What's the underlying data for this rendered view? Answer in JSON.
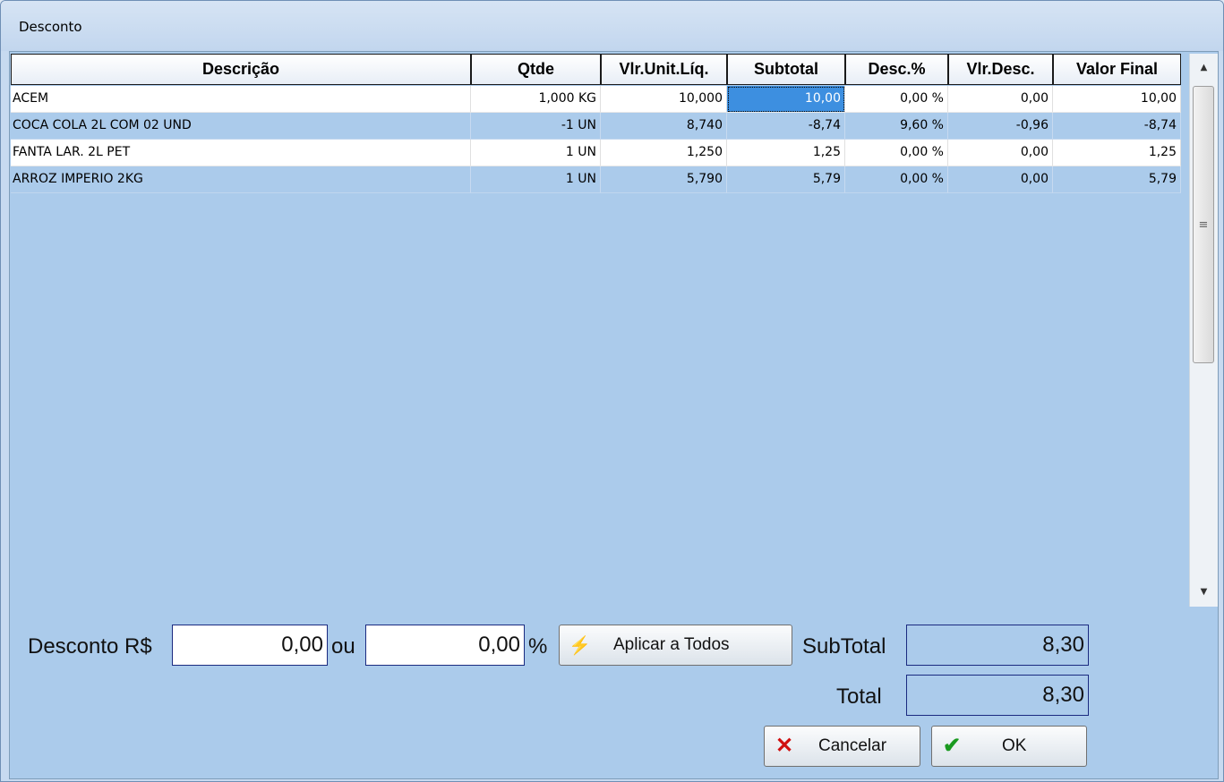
{
  "window": {
    "title": "Desconto"
  },
  "grid": {
    "columns": [
      "Descrição",
      "Qtde",
      "Vlr.Unit.Líq.",
      "Subtotal",
      "Desc.%",
      "Vlr.Desc.",
      "Valor Final"
    ],
    "rows": [
      [
        "ACEM",
        "1,000 KG",
        "10,000",
        "10,00",
        "0,00 %",
        "0,00",
        "10,00"
      ],
      [
        "COCA COLA 2L COM 02 UND",
        "-1 UN",
        "8,740",
        "-8,74",
        "9,60 %",
        "-0,96",
        "-8,74"
      ],
      [
        "FANTA LAR. 2L PET",
        "1 UN",
        "1,250",
        "1,25",
        "0,00 %",
        "0,00",
        "1,25"
      ],
      [
        "ARROZ IMPERIO 2KG",
        "1 UN",
        "5,790",
        "5,79",
        "0,00 %",
        "0,00",
        "5,79"
      ]
    ]
  },
  "scrollbar": {
    "up_icon": "arrow-up-icon",
    "down_icon": "arrow-down-icon"
  },
  "footer": {
    "desconto_label": "Desconto R$",
    "desconto_value": "0,00",
    "ou_label": "ou",
    "percent_value": "0,00",
    "percent_sign": "%",
    "aplicar_label": "Aplicar a Todos",
    "subtotal_label": "SubTotal",
    "subtotal_value": "8,30",
    "total_label": "Total",
    "total_value": "8,30",
    "cancelar_label": "Cancelar",
    "ok_label": "OK"
  },
  "colors": {
    "accent": "#3d8fe0",
    "panel": "#abcbeb",
    "border": "#1a2a80"
  }
}
